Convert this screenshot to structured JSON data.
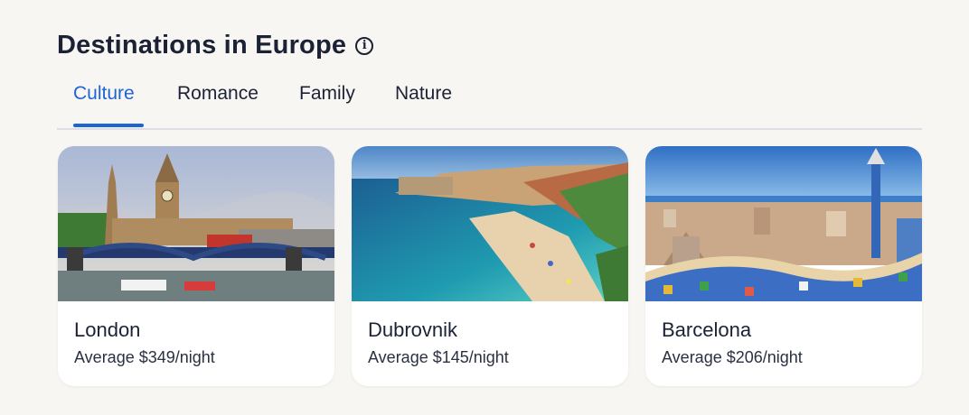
{
  "header": {
    "title": "Destinations in Europe",
    "info_icon": "info-icon"
  },
  "tabs": [
    {
      "label": "Culture",
      "active": true
    },
    {
      "label": "Romance",
      "active": false
    },
    {
      "label": "Family",
      "active": false
    },
    {
      "label": "Nature",
      "active": false
    }
  ],
  "cards": [
    {
      "name": "London",
      "price": "Average $349/night",
      "image": "london-photo"
    },
    {
      "name": "Dubrovnik",
      "price": "Average $145/night",
      "image": "dubrovnik-photo"
    },
    {
      "name": "Barcelona",
      "price": "Average $206/night",
      "image": "barcelona-photo"
    }
  ],
  "colors": {
    "accent": "#1e64d6",
    "text": "#1c2236",
    "background": "#f8f6f2"
  }
}
